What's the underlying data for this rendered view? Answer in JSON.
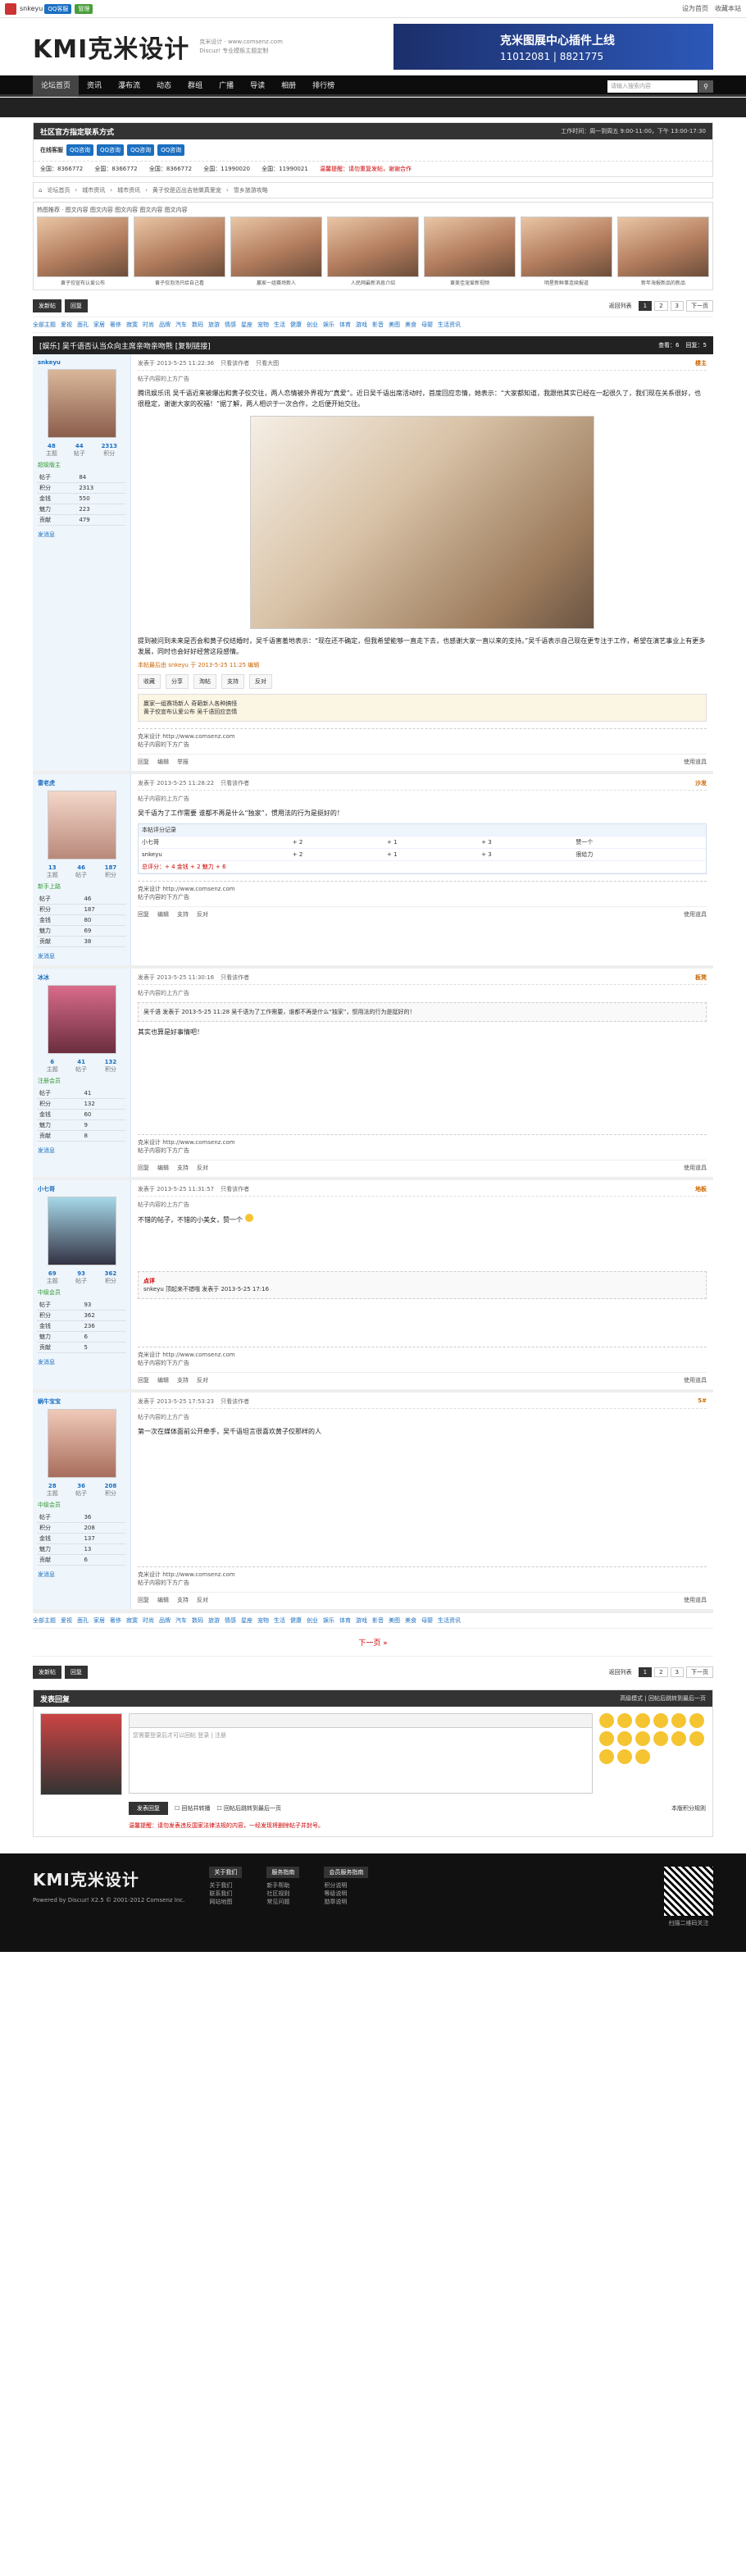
{
  "topbar": {
    "user": "snkeyu",
    "tag1": "QQ客服",
    "tag2": "管理",
    "links": [
      "设为首页",
      "收藏本站"
    ]
  },
  "header": {
    "logo": "KMI克米设计",
    "sub1": "克米设计 · www.comsenz.com",
    "sub2": "Discuz! 专业模板主题定制",
    "banner_line1": "克米图展中心插件上线",
    "banner_line2": "11012081 | 8821775"
  },
  "nav": {
    "items": [
      "论坛首页",
      "资讯",
      "瀑布流",
      "动态",
      "群组",
      "广播",
      "导读",
      "相册",
      "排行榜"
    ],
    "search_placeholder": "请输入搜索内容"
  },
  "contact": {
    "title": "社区官方指定联系方式",
    "right": "工作时间：周一到周五 9:00-11:00，下午 13:00-17:30",
    "qq": [
      "QQ咨询",
      "QQ咨询",
      "QQ咨询",
      "QQ咨询"
    ],
    "label": "在线客服",
    "phones": [
      "全国：8366772",
      "全国：8366772",
      "全国：8366772",
      "全国：11990020",
      "全国：11990021"
    ],
    "notice": "温馨提醒：请勿重复发帖，谢谢合作"
  },
  "crumb": [
    "论坛首页",
    "城市资讯",
    "城市资讯",
    "黄子佼是迈出吉他做真爱宠",
    "雪乡旅游攻略"
  ],
  "photos": {
    "title": "热图推荐 · 图文内容 图文内容 图文内容 图文内容 图文内容",
    "captions": [
      "黄子佼宣布认爱公布",
      "黄子佼泡汤只给自己看",
      "赢家一组赛场新人",
      "人民网最新消息介绍",
      "黄美佳宠爱新视频",
      "明星新鲜事连续报道",
      "新年海报新品的新品"
    ]
  },
  "pager": {
    "new_label": "发新帖",
    "reply_label": "回复",
    "back": "返回列表",
    "pages": [
      "1",
      "2",
      "3",
      "下一页"
    ]
  },
  "tags": [
    "全部主题",
    "爱视",
    "面孔",
    "家居",
    "奢侈",
    "寂寞",
    "时尚",
    "品牌",
    "汽车",
    "数码",
    "旅游",
    "情感",
    "星座",
    "宠物",
    "生活",
    "健康",
    "创业",
    "娱乐",
    "体育",
    "游戏",
    "影音",
    "美图",
    "美食",
    "母婴",
    "生活资讯"
  ],
  "thread": {
    "title": "[娱乐] 吴千语否认当众向主席亲吻亲吻熊 [复制链接]",
    "views": "查看：6",
    "replies": "回复：5"
  },
  "post1": {
    "user": "snkeyu",
    "nums": [
      {
        "v": "48",
        "l": "主题"
      },
      {
        "v": "44",
        "l": "帖子"
      },
      {
        "v": "2313",
        "l": "积分"
      }
    ],
    "level": "超级版主",
    "stats": [
      [
        "帖子",
        "84"
      ],
      [
        "积分",
        "2313"
      ],
      [
        "金钱",
        "550"
      ],
      [
        "魅力",
        "223"
      ],
      [
        "贡献",
        "479"
      ]
    ],
    "acts": "发消息",
    "meta": "发表于 2013-5-25 11:22:36",
    "mode": "只看该作者",
    "big": "只看大图",
    "floor": "楼主",
    "ad": "帖子内容的上方广告",
    "body1": "腾讯娱乐讯 吴千语近来被爆出和黄子佼交往，两人恋情被外界视为“真爱”。近日吴千语出席活动时，首度回应恋情，她表示：“大家都知道，我跟他其实已经在一起很久了，我们现在关系很好，也很稳定，谢谢大家的祝福！”据了解，两人相识于一次合作，之后便开始交往。",
    "body2": "提到被问到未来是否会和黄子佼结婚时，吴千语害羞地表示：“现在还不确定，但我希望能够一直走下去，也感谢大家一直以来的支持。”吴千语表示自己现在更专注于工作，希望在演艺事业上有更多发展，同时也会好好经营这段感情。",
    "tag_label": "本帖最后由 snkeyu 于 2013-5-25 11:25 编辑",
    "share": [
      "收藏",
      "分享",
      "淘帖",
      "支持",
      "反对"
    ],
    "related": [
      "赢家一组赛场新人 奇葩新人各种搞怪",
      "黄子佼宣布认爱公布 吴千语回应恋情"
    ],
    "sig": "克米设计 http://www.comsenz.com",
    "sig2": "帖子内容的下方广告",
    "tools": [
      "回复",
      "编辑",
      "举报"
    ],
    "toolr": "使用道具"
  },
  "post2": {
    "user": "雷老虎",
    "nums": [
      {
        "v": "13",
        "l": "主题"
      },
      {
        "v": "46",
        "l": "帖子"
      },
      {
        "v": "187",
        "l": "积分"
      }
    ],
    "level": "新手上路",
    "stats": [
      [
        "帖子",
        "46"
      ],
      [
        "积分",
        "187"
      ],
      [
        "金钱",
        "80"
      ],
      [
        "魅力",
        "69"
      ],
      [
        "贡献",
        "38"
      ]
    ],
    "acts": "发消息",
    "meta": "发表于 2013-5-25 11:28:22",
    "mode": "只看该作者",
    "floor": "沙发",
    "ad": "帖子内容的上方广告",
    "body": "吴千语为了工作需要 谁都不再是什么“独家”，惯用法的行为是挺好的！",
    "rate_title": "本帖评分记录",
    "rate_rows": [
      [
        "小七哥",
        "+ 2",
        "+ 1",
        "+ 3",
        "赞一个"
      ],
      [
        "snkeyu",
        "+ 2",
        "+ 1",
        "+ 3",
        "很给力"
      ]
    ],
    "rate_sum": "总评分：+ 4  金钱 + 2  魅力 + 6",
    "sig": "克米设计 http://www.comsenz.com",
    "sig2": "帖子内容的下方广告",
    "tools": [
      "回复",
      "编辑",
      "支持",
      "反对"
    ],
    "toolr": "使用道具"
  },
  "post3": {
    "user": "冰冰",
    "nums": [
      {
        "v": "6",
        "l": "主题"
      },
      {
        "v": "41",
        "l": "帖子"
      },
      {
        "v": "132",
        "l": "积分"
      }
    ],
    "level": "注册会员",
    "stats": [
      [
        "帖子",
        "41"
      ],
      [
        "积分",
        "132"
      ],
      [
        "金钱",
        "60"
      ],
      [
        "魅力",
        "9"
      ],
      [
        "贡献",
        "8"
      ]
    ],
    "acts": "发消息",
    "meta": "发表于 2013-5-25 11:30:16",
    "mode": "只看该作者",
    "floor": "板凳",
    "ad": "帖子内容的上方广告",
    "quote": "吴千语 发表于 2013-5-25 11:28 吴千语为了工作需要，谁都不再是什么“独家”，惯用法的行为是挺好的！",
    "body": "其实也算是好事情吧！",
    "sig": "克米设计 http://www.comsenz.com",
    "sig2": "帖子内容的下方广告",
    "tools": [
      "回复",
      "编辑",
      "支持",
      "反对"
    ],
    "toolr": "使用道具"
  },
  "post4": {
    "user": "小七哥",
    "nums": [
      {
        "v": "69",
        "l": "主题"
      },
      {
        "v": "93",
        "l": "帖子"
      },
      {
        "v": "362",
        "l": "积分"
      }
    ],
    "level": "中级会员",
    "stats": [
      [
        "帖子",
        "93"
      ],
      [
        "积分",
        "362"
      ],
      [
        "金钱",
        "236"
      ],
      [
        "魅力",
        "6"
      ],
      [
        "贡献",
        "5"
      ]
    ],
    "acts": "发消息",
    "meta": "发表于 2013-5-25 11:31:57",
    "mode": "只看该作者",
    "floor": "地板",
    "ad": "帖子内容的上方广告",
    "body": "不错的帖子，不错的小美女，赞一个",
    "comment_title": "点评",
    "comment": "snkeyu 顶起来不错哦 发表于 2013-5-25 17:16",
    "sig": "克米设计 http://www.comsenz.com",
    "sig2": "帖子内容的下方广告",
    "tools": [
      "回复",
      "编辑",
      "支持",
      "反对"
    ],
    "toolr": "使用道具"
  },
  "post5": {
    "user": "蜗牛宝宝",
    "nums": [
      {
        "v": "28",
        "l": "主题"
      },
      {
        "v": "36",
        "l": "帖子"
      },
      {
        "v": "208",
        "l": "积分"
      }
    ],
    "level": "中级会员",
    "stats": [
      [
        "帖子",
        "36"
      ],
      [
        "积分",
        "208"
      ],
      [
        "金钱",
        "137"
      ],
      [
        "魅力",
        "13"
      ],
      [
        "贡献",
        "6"
      ]
    ],
    "acts": "发消息",
    "meta": "发表于 2013-5-25 17:53:23",
    "mode": "只看该作者",
    "floor": "5#",
    "ad": "帖子内容的上方广告",
    "body": "第一次在媒体面前公开牵手，吴千语坦言很喜欢黄子佼那样的人",
    "sig": "克米设计 http://www.comsenz.com",
    "sig2": "帖子内容的下方广告",
    "tools": [
      "回复",
      "编辑",
      "支持",
      "反对"
    ],
    "toolr": "使用道具"
  },
  "nextpage": "下一页 »",
  "reply": {
    "title": "发表回复",
    "right": "高级模式 | 回帖后跳转到最后一页",
    "placeholder": "您需要登录后才可以回帖 登录 | 注册",
    "submit": "发表回复",
    "opt1": "回帖并转播",
    "opt2": "回帖后跳转到最后一页",
    "warn": "温馨提醒：请勿发表违反国家法律法规的内容，一经发现将删除帖子并封号。",
    "score": "本版积分规则"
  },
  "footer": {
    "logo": "KMI克米设计",
    "copy": "Powered by Discuz! X2.5 © 2001-2012 Comsenz Inc.",
    "cols": [
      {
        "t": "关于我们",
        "items": [
          "关于我们",
          "联系我们",
          "网站地图"
        ]
      },
      {
        "t": "服务指南",
        "items": [
          "新手帮助",
          "社区规则",
          "常见问题"
        ]
      },
      {
        "t": "会员服务指南",
        "items": [
          "积分说明",
          "等级说明",
          "勋章说明"
        ]
      }
    ],
    "qr": "扫描二维码关注"
  }
}
